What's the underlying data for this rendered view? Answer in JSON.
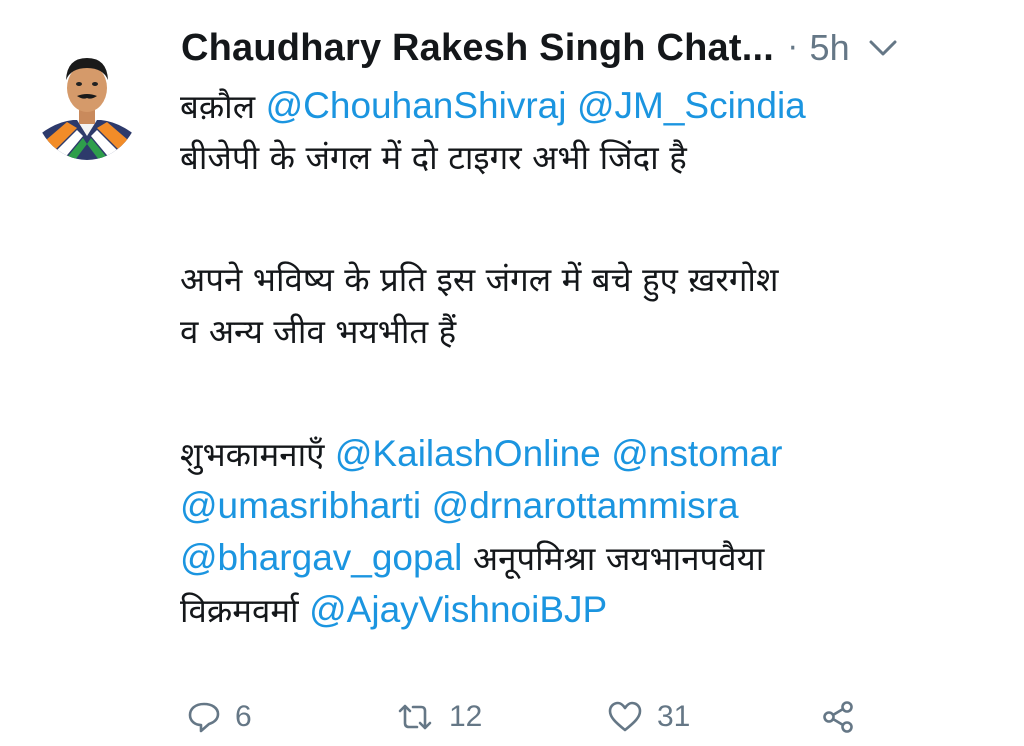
{
  "tweet": {
    "author_name": "Chaudhary Rakesh Singh Chat...",
    "separator": "·",
    "time": "5h",
    "text": {
      "l1_text": "बक़ौल",
      "l1_mention1": "@ChouhanShivraj",
      "l1_mention2": "@JM_Scindia",
      "l2": "बीजेपी के जंगल में दो टाइगर अभी जिंदा है",
      "l3": "अपने भविष्य के प्रति इस जंगल में बचे हुए ख़रगोश",
      "l4": "व अन्य जीव भयभीत हैं",
      "l5_text": "शुभकामनाएँ",
      "l5_mention1": "@KailashOnline",
      "l5_mention2": "@nstomar",
      "l6_mention1": "@umasribharti",
      "l6_mention2": "@drnarottammisra",
      "l7_mention": "@bhargav_gopal",
      "l7_text": "अनूपमिश्रा जयभानपवैया",
      "l8_text": "विक्रमवर्मा",
      "l8_mention": "@AjayVishnoiBJP"
    },
    "actions": {
      "reply_count": "6",
      "retweet_count": "12",
      "like_count": "31"
    }
  },
  "icons": [
    "reply-icon",
    "retweet-icon",
    "like-icon",
    "share-icon",
    "chevron-down-icon"
  ],
  "colors": {
    "link": "#1b95e0",
    "muted": "#657786",
    "text": "#14171a"
  }
}
